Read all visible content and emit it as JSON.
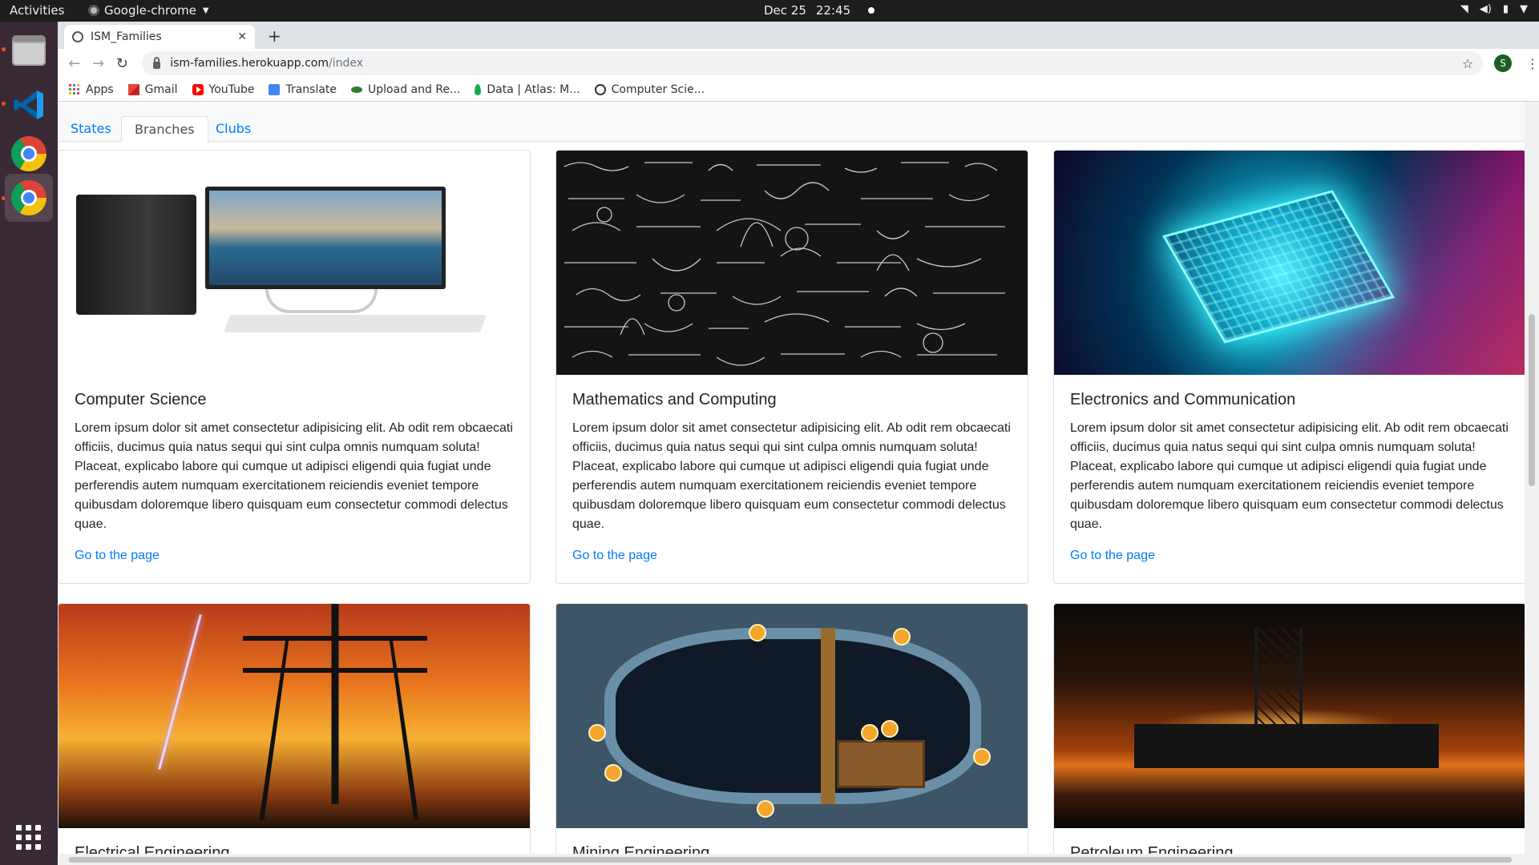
{
  "system": {
    "activities": "Activities",
    "app_name": "Google-chrome",
    "date": "Dec 25",
    "time": "22:45"
  },
  "browser": {
    "tab_title": "ISM_Families",
    "url_host": "ism-families.herokuapp.com",
    "url_path": "/index",
    "profile_initial": "S",
    "bookmarks": [
      {
        "label": "Apps",
        "icon": "apps-grid-icon"
      },
      {
        "label": "Gmail",
        "icon": "gmail-icon"
      },
      {
        "label": "YouTube",
        "icon": "youtube-icon"
      },
      {
        "label": "Translate",
        "icon": "translate-icon"
      },
      {
        "label": "Upload and Re...",
        "icon": "upload-icon"
      },
      {
        "label": "Data | Atlas: M...",
        "icon": "mongodb-leaf-icon"
      },
      {
        "label": "Computer Scie...",
        "icon": "globe-icon"
      }
    ]
  },
  "page": {
    "nav_tabs": [
      {
        "label": "States",
        "active": false
      },
      {
        "label": "Branches",
        "active": true
      },
      {
        "label": "Clubs",
        "active": false
      }
    ],
    "cards": [
      {
        "title": "Computer Science",
        "text": "Lorem ipsum dolor sit amet consectetur adipisicing elit. Ab odit rem obcaecati officiis, ducimus quia natus sequi qui sint culpa omnis numquam soluta! Placeat, explicabo labore qui cumque ut adipisci eligendi quia fugiat unde perferendis autem numquam exercitationem reiciendis eveniet tempore quibusdam doloremque libero quisquam eum consectetur commodi delectus quae.",
        "link": "Go to the page"
      },
      {
        "title": "Mathematics and Computing",
        "text": "Lorem ipsum dolor sit amet consectetur adipisicing elit. Ab odit rem obcaecati officiis, ducimus quia natus sequi qui sint culpa omnis numquam soluta! Placeat, explicabo labore qui cumque ut adipisci eligendi quia fugiat unde perferendis autem numquam exercitationem reiciendis eveniet tempore quibusdam doloremque libero quisquam eum consectetur commodi delectus quae.",
        "link": "Go to the page"
      },
      {
        "title": "Electronics and Communication",
        "text": "Lorem ipsum dolor sit amet consectetur adipisicing elit. Ab odit rem obcaecati officiis, ducimus quia natus sequi qui sint culpa omnis numquam soluta! Placeat, explicabo labore qui cumque ut adipisci eligendi quia fugiat unde perferendis autem numquam exercitationem reiciendis eveniet tempore quibusdam doloremque libero quisquam eum consectetur commodi delectus quae.",
        "link": "Go to the page"
      },
      {
        "title": "Electrical Engineering"
      },
      {
        "title": "Mining Engineering"
      },
      {
        "title": "Petroleum Engineering"
      }
    ]
  }
}
